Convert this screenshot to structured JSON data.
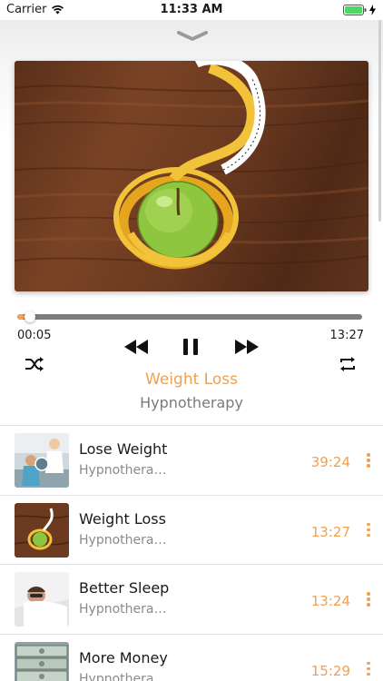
{
  "status_bar": {
    "carrier": "Carrier",
    "time": "11:33 AM"
  },
  "player": {
    "collapse_icon": "chevron-down-icon",
    "artwork_description_icon": "apple-tape-artwork",
    "progress": {
      "current": "00:05",
      "total": "13:27",
      "fraction": 0.02
    },
    "now_playing": {
      "title": "Weight Loss",
      "subtitle": "Hypnotherapy"
    },
    "controls": {
      "shuffle_icon": "shuffle-icon",
      "previous_icon": "rewind-icon",
      "pause_icon": "pause-icon",
      "next_icon": "fast-forward-icon",
      "repeat_icon": "repeat-icon"
    }
  },
  "colors": {
    "accent": "#f0a050",
    "progress_track": "#7d7d7d",
    "battery": "#4cd964"
  },
  "tracks": [
    {
      "title": "Lose Weight",
      "subtitle": "Hypnothera…",
      "duration": "39:24",
      "thumb": "gym-thumbnail"
    },
    {
      "title": "Weight Loss",
      "subtitle": "Hypnothera…",
      "duration": "13:27",
      "thumb": "apple-thumbnail"
    },
    {
      "title": "Better Sleep",
      "subtitle": "Hypnothera…",
      "duration": "13:24",
      "thumb": "sleep-thumbnail"
    },
    {
      "title": "More Money",
      "subtitle": "Hypnothera…",
      "duration": "15:29",
      "thumb": "money-thumbnail"
    }
  ]
}
